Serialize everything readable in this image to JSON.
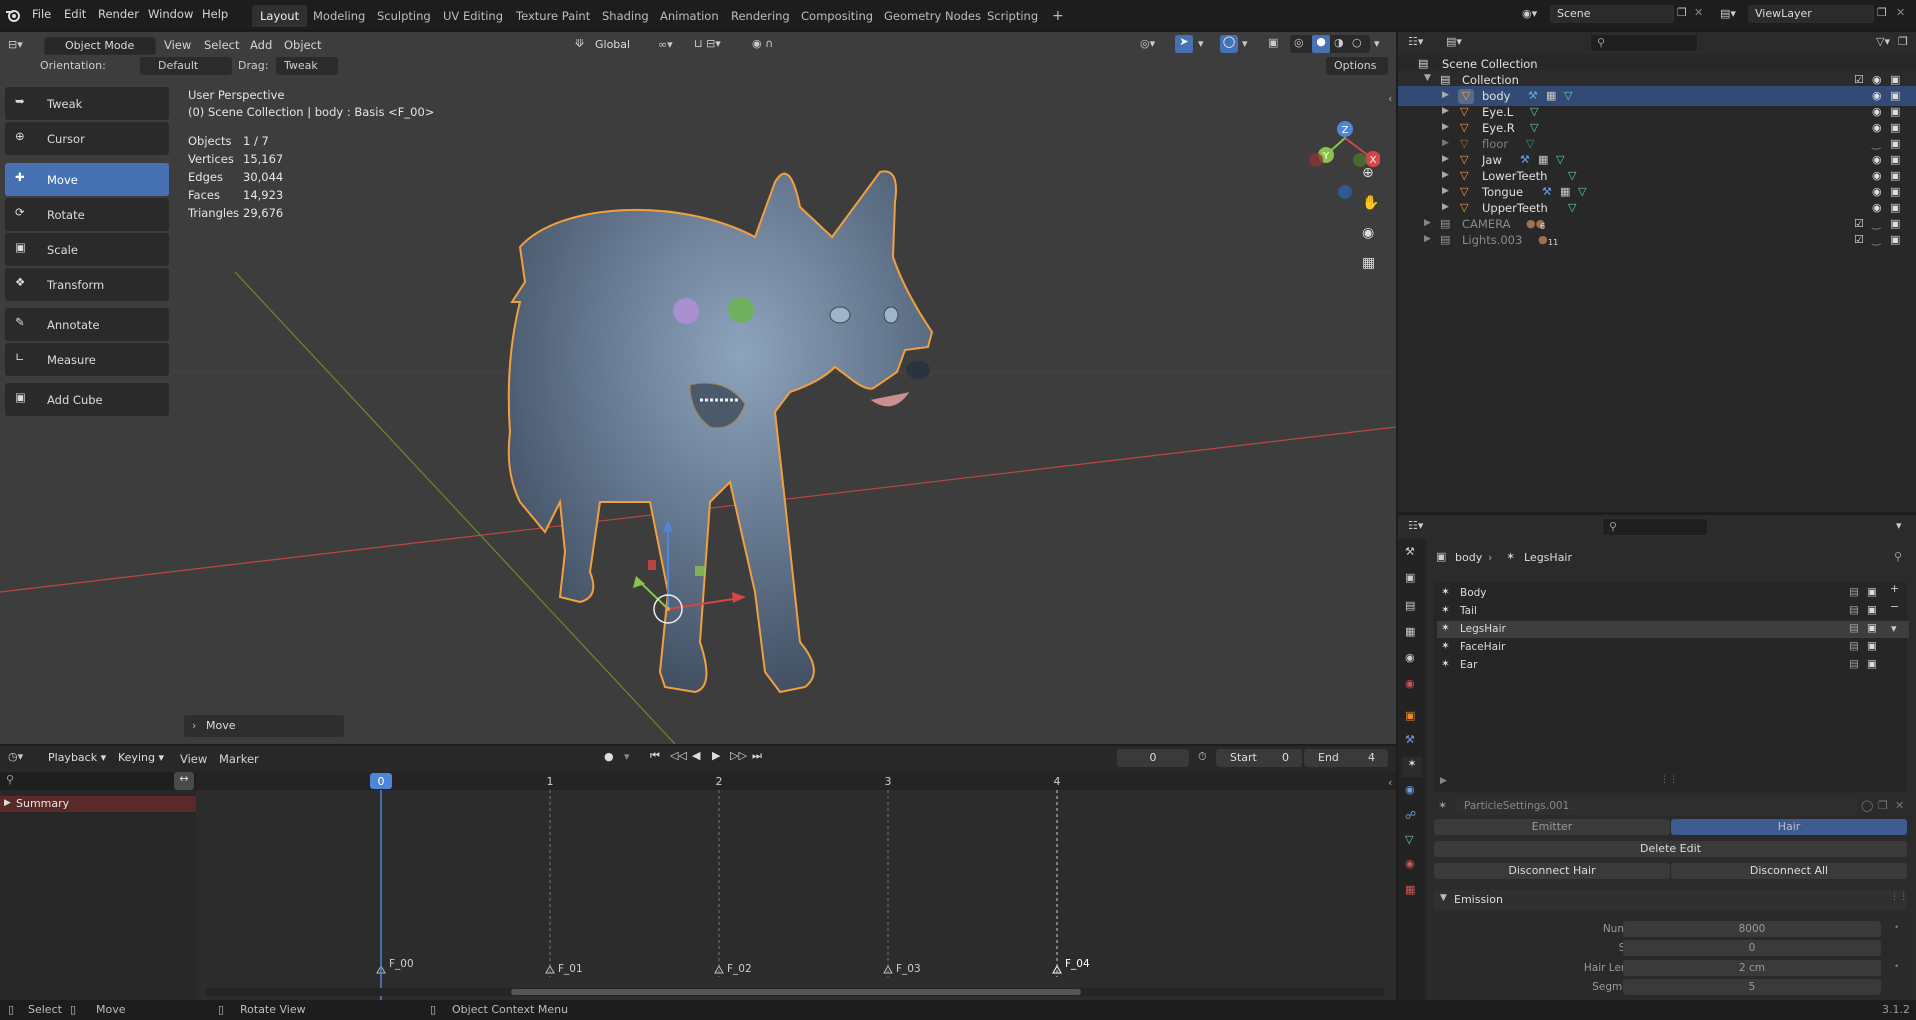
{
  "topbar": {
    "menus": [
      "File",
      "Edit",
      "Render",
      "Window",
      "Help"
    ],
    "workspaces": [
      "Layout",
      "Modeling",
      "Sculpting",
      "UV Editing",
      "Texture Paint",
      "Shading",
      "Animation",
      "Rendering",
      "Compositing",
      "Geometry Nodes",
      "Scripting"
    ],
    "add_tab": "+",
    "scene": "Scene",
    "view_layer": "ViewLayer"
  },
  "viewport_header": {
    "mode": "Object Mode",
    "menus": [
      "View",
      "Select",
      "Add",
      "Object"
    ],
    "transform_orientation": "Global",
    "orientation_label": "Orientation:",
    "orientation_value": "Default",
    "drag_label": "Drag:",
    "drag_value": "Tweak",
    "options": "Options"
  },
  "tools": [
    "Tweak",
    "Cursor",
    "Move",
    "Rotate",
    "Scale",
    "Transform",
    "Annotate",
    "Measure",
    "Add Cube"
  ],
  "overlay_info": {
    "perspective": "User Perspective",
    "context": "(0) Scene Collection | body : Basis <F_00>",
    "stats": [
      {
        "label": "Objects",
        "value": "1 / 7"
      },
      {
        "label": "Vertices",
        "value": "15,167"
      },
      {
        "label": "Edges",
        "value": "30,044"
      },
      {
        "label": "Faces",
        "value": "14,923"
      },
      {
        "label": "Triangles",
        "value": "29,676"
      }
    ]
  },
  "gizmo_axes": {
    "x": "X",
    "y": "Y",
    "z": "Z"
  },
  "last_operator": "Move",
  "outliner": {
    "scene_collection": "Scene Collection",
    "collection": "Collection",
    "objects": [
      "body",
      "Eye.L",
      "Eye.R",
      "floor",
      "Jaw",
      "LowerTeeth",
      "Tongue",
      "UpperTeeth"
    ],
    "collections": [
      {
        "name": "CAMERA",
        "count": "6"
      },
      {
        "name": "Lights.003",
        "count": "11"
      }
    ]
  },
  "properties": {
    "breadcrumb_object": "body",
    "breadcrumb_system": "LegsHair",
    "particle_systems": [
      "Body",
      "Tail",
      "LegsHair",
      "FaceHair",
      "Ear"
    ],
    "settings_name": "ParticleSettings.001",
    "type_emitter": "Emitter",
    "type_hair": "Hair",
    "delete_edit": "Delete Edit",
    "disconnect_hair": "Disconnect Hair",
    "disconnect_all": "Disconnect All",
    "emission_title": "Emission",
    "emission": [
      {
        "label": "Number",
        "value": "8000"
      },
      {
        "label": "Seed",
        "value": "0"
      },
      {
        "label": "Hair Length",
        "value": "2 cm"
      },
      {
        "label": "Segments",
        "value": "5"
      }
    ]
  },
  "timeline": {
    "menus": [
      "Playback",
      "Keying",
      "View",
      "Marker"
    ],
    "current_frame": "0",
    "start_label": "Start",
    "start_value": "0",
    "end_label": "End",
    "end_value": "4",
    "summary": "Summary",
    "frames": [
      "0",
      "1",
      "2",
      "3",
      "4"
    ],
    "markers": [
      "F_00",
      "F_01",
      "F_02",
      "F_03",
      "F_04"
    ]
  },
  "statusbar": {
    "select": "Select",
    "move": "Move",
    "rotate_view": "Rotate View",
    "context_menu": "Object Context Menu",
    "version": "3.1.2"
  },
  "colors": {
    "accent": "#4672b3",
    "selection_outline": "#f0a040",
    "summary_bg": "#5a2a2a",
    "playhead": "#4f86d8"
  }
}
